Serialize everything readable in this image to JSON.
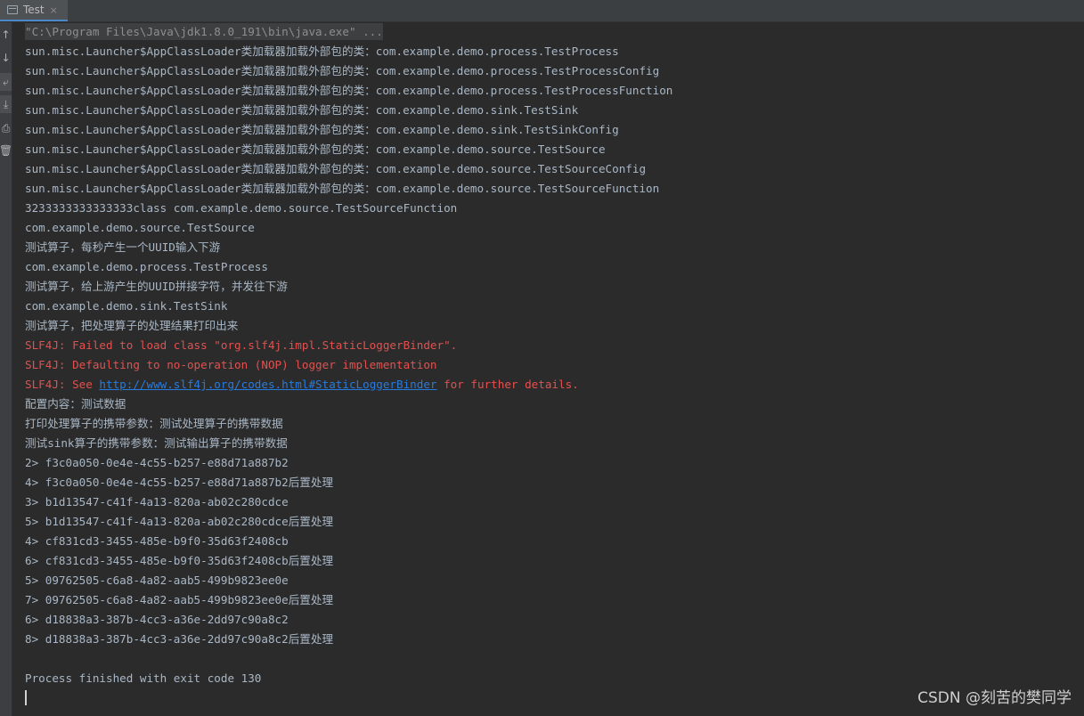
{
  "tab": {
    "title": "Test",
    "close": "×"
  },
  "gutter": {
    "buttons": [
      {
        "name": "up-arrow-icon",
        "glyph": "↑"
      },
      {
        "name": "down-arrow-icon",
        "glyph": "↓"
      },
      {
        "name": "soft-wrap-icon",
        "glyph": "⤶"
      },
      {
        "name": "scroll-to-end-icon",
        "glyph": "⤓"
      },
      {
        "name": "print-icon",
        "glyph": "⎙"
      },
      {
        "name": "trash-icon",
        "glyph": "🗑"
      }
    ]
  },
  "console": {
    "command": "\"C:\\Program Files\\Java\\jdk1.8.0_191\\bin\\java.exe\" ...",
    "loader_lines": [
      "sun.misc.Launcher$AppClassLoader类加载器加载外部包的类：com.example.demo.process.TestProcess",
      "sun.misc.Launcher$AppClassLoader类加载器加载外部包的类：com.example.demo.process.TestProcessConfig",
      "sun.misc.Launcher$AppClassLoader类加载器加载外部包的类：com.example.demo.process.TestProcessFunction",
      "sun.misc.Launcher$AppClassLoader类加载器加载外部包的类：com.example.demo.sink.TestSink",
      "sun.misc.Launcher$AppClassLoader类加载器加载外部包的类：com.example.demo.sink.TestSinkConfig",
      "sun.misc.Launcher$AppClassLoader类加载器加载外部包的类：com.example.demo.source.TestSource",
      "sun.misc.Launcher$AppClassLoader类加载器加载外部包的类：com.example.demo.source.TestSourceConfig",
      "sun.misc.Launcher$AppClassLoader类加载器加载外部包的类：com.example.demo.source.TestSourceFunction"
    ],
    "info_lines": [
      "3233333333333333class com.example.demo.source.TestSourceFunction",
      "com.example.demo.source.TestSource",
      "测试算子，每秒产生一个UUID输入下游",
      "com.example.demo.process.TestProcess",
      "测试算子，给上游产生的UUID拼接字符，并发往下游",
      "com.example.demo.sink.TestSink",
      "测试算子，把处理算子的处理结果打印出来"
    ],
    "errors": {
      "line1": "SLF4J: Failed to load class \"org.slf4j.impl.StaticLoggerBinder\".",
      "line2": "SLF4J: Defaulting to no-operation (NOP) logger implementation",
      "line3_prefix": "SLF4J: See ",
      "line3_link": "http://www.slf4j.org/codes.html#StaticLoggerBinder",
      "line3_suffix": " for further details."
    },
    "config_lines": [
      "配置内容：测试数据",
      "打印处理算子的携带参数：测试处理算子的携带数据",
      "测试sink算子的携带参数：测试输出算子的携带数据"
    ],
    "output_lines": [
      "2> f3c0a050-0e4e-4c55-b257-e88d71a887b2",
      "4> f3c0a050-0e4e-4c55-b257-e88d71a887b2后置处理",
      "3> b1d13547-c41f-4a13-820a-ab02c280cdce",
      "5> b1d13547-c41f-4a13-820a-ab02c280cdce后置处理",
      "4> cf831cd3-3455-485e-b9f0-35d63f2408cb",
      "6> cf831cd3-3455-485e-b9f0-35d63f2408cb后置处理",
      "5> 09762505-c6a8-4a82-aab5-499b9823ee0e",
      "7> 09762505-c6a8-4a82-aab5-499b9823ee0e后置处理",
      "6> d18838a3-387b-4cc3-a36e-2dd97c90a8c2",
      "8> d18838a3-387b-4cc3-a36e-2dd97c90a8c2后置处理"
    ],
    "exit_line": "Process finished with exit code 130"
  },
  "watermark": "CSDN @刻苦的樊同学"
}
